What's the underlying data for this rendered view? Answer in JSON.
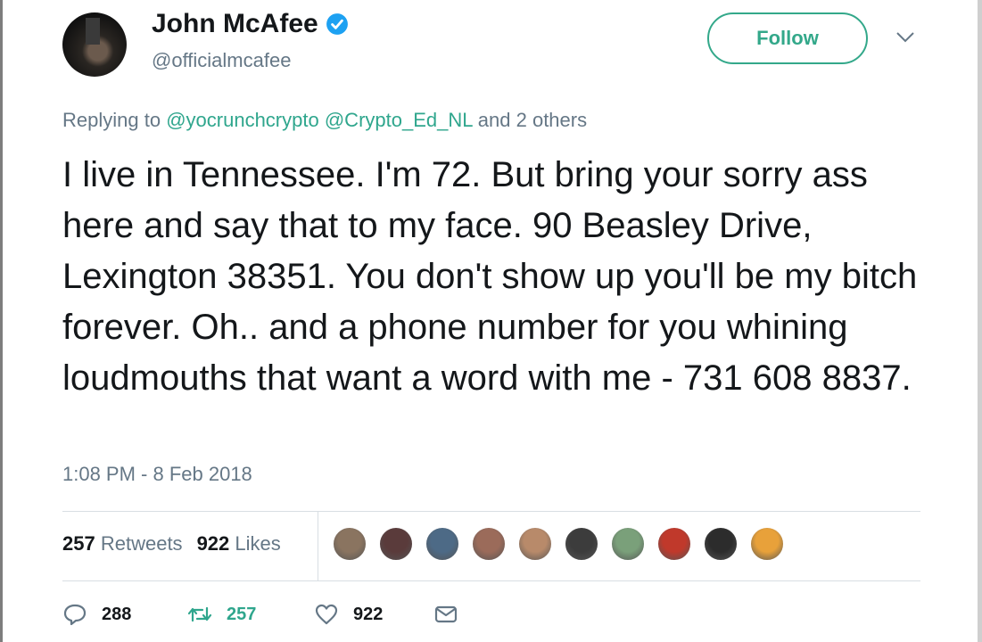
{
  "author": {
    "display_name": "John McAfee",
    "handle": "@officialmcafee",
    "verified": true
  },
  "follow_button": {
    "label": "Follow"
  },
  "reply": {
    "prefix": "Replying to",
    "mentions": [
      "@yocrunchcrypto",
      "@Crypto_Ed_NL"
    ],
    "suffix": "and 2 others"
  },
  "tweet": {
    "text": "I live in Tennessee. I'm 72. But bring your sorry ass here and say that to my face. 90 Beasley Drive, Lexington 38351. You don't show up you'll be my bitch forever. Oh.. and a phone number for you whining loudmouths that want a word with me - 731 608 8837.",
    "timestamp": "1:08 PM - 8 Feb 2018"
  },
  "stats": {
    "retweets_count": "257",
    "retweets_label": "Retweets",
    "likes_count": "922",
    "likes_label": "Likes"
  },
  "likers": [
    {
      "color": "#8a7460"
    },
    {
      "color": "#5a3b3b"
    },
    {
      "color": "#4d6a86"
    },
    {
      "color": "#9b6b5a"
    },
    {
      "color": "#b88a6a"
    },
    {
      "color": "#3c3c3c"
    },
    {
      "color": "#7aa07a"
    },
    {
      "color": "#c0392b"
    },
    {
      "color": "#2c2c2c"
    },
    {
      "color": "#e8a13a"
    }
  ],
  "actions": {
    "reply_count": "288",
    "retweet_count": "257",
    "like_count": "922"
  },
  "colors": {
    "accent": "#2fa68d",
    "muted": "#657786",
    "verified": "#1da1f2"
  }
}
